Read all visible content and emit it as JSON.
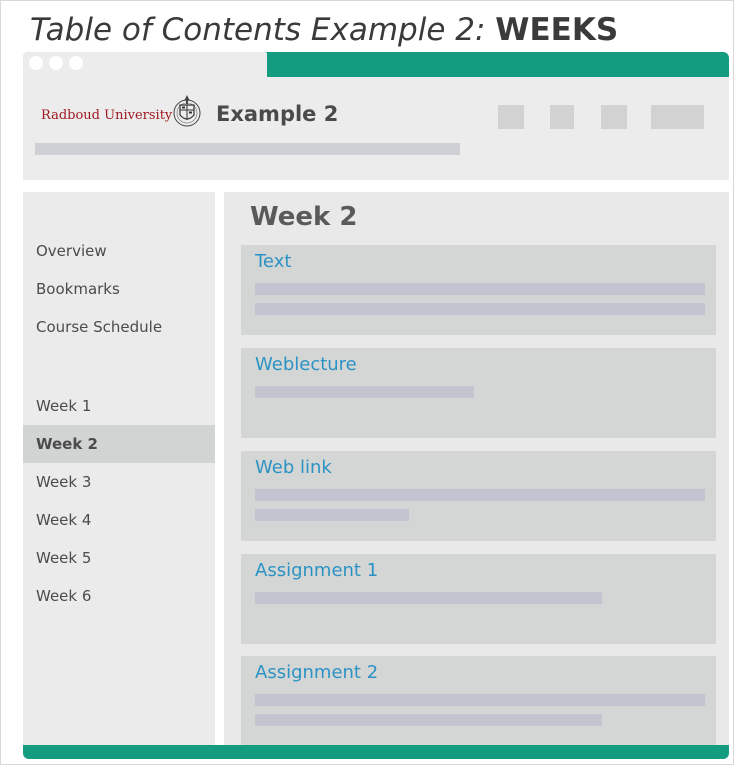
{
  "heading": {
    "italic": "Table of Contents Example 2:",
    "bold": "WEEKS"
  },
  "window": {
    "brand": "Radboud University",
    "title": "Example 2",
    "accent_color": "#149c81",
    "link_color": "#2b93c3"
  },
  "sidebar": {
    "items": [
      {
        "label": "Overview"
      },
      {
        "label": "Bookmarks"
      },
      {
        "label": "Course Schedule"
      },
      {
        "label": "Week 1"
      },
      {
        "label": "Week 2",
        "active": true
      },
      {
        "label": "Week 3"
      },
      {
        "label": "Week 4"
      },
      {
        "label": "Week 5"
      },
      {
        "label": "Week 6"
      }
    ]
  },
  "main": {
    "title": "Week 2",
    "cards": [
      {
        "title": "Text"
      },
      {
        "title": "Weblecture"
      },
      {
        "title": "Web link"
      },
      {
        "title": "Assignment 1"
      },
      {
        "title": "Assignment 2"
      }
    ]
  },
  "icons": {
    "dots": "window-dots-icon",
    "crest": "university-crest-icon"
  }
}
